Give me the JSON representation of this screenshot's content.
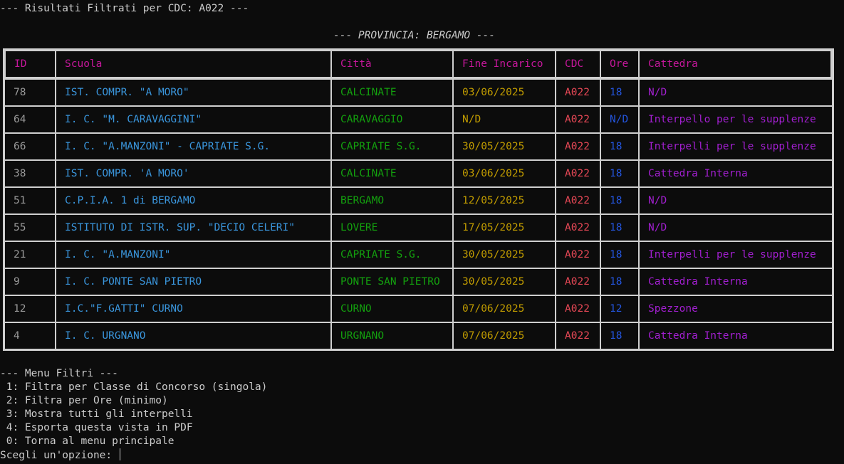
{
  "header": {
    "title": "--- Risultati Filtrati per CDC: A022 ---",
    "province": "--- PROVINCIA: BERGAMO ---"
  },
  "table": {
    "columns": [
      "ID",
      "Scuola",
      "Città",
      "Fine Incarico",
      "CDC",
      "Ore",
      "Cattedra"
    ],
    "rows": [
      {
        "id": "78",
        "scuola": "IST. COMPR. \"A MORO\"",
        "citta": "CALCINATE",
        "fine": "03/06/2025",
        "cdc": "A022",
        "ore": "18",
        "cattedra": "N/D"
      },
      {
        "id": "64",
        "scuola": "I. C. \"M. CARAVAGGINI\"",
        "citta": "CARAVAGGIO",
        "fine": "N/D",
        "cdc": "A022",
        "ore": "N/D",
        "cattedra": "Interpello per le supplenze"
      },
      {
        "id": "66",
        "scuola": "I. C. \"A.MANZONI\" - CAPRIATE S.G.",
        "citta": "CAPRIATE S.G.",
        "fine": "30/05/2025",
        "cdc": "A022",
        "ore": "18",
        "cattedra": "Interpelli per le supplenze"
      },
      {
        "id": "38",
        "scuola": "IST. COMPR. 'A MORO'",
        "citta": "CALCINATE",
        "fine": "03/06/2025",
        "cdc": "A022",
        "ore": "18",
        "cattedra": "Cattedra Interna"
      },
      {
        "id": "51",
        "scuola": "C.P.I.A. 1 di BERGAMO",
        "citta": "BERGAMO",
        "fine": "12/05/2025",
        "cdc": "A022",
        "ore": "18",
        "cattedra": "N/D"
      },
      {
        "id": "55",
        "scuola": "ISTITUTO DI ISTR. SUP. \"DECIO CELERI\"",
        "citta": "LOVERE",
        "fine": "17/05/2025",
        "cdc": "A022",
        "ore": "18",
        "cattedra": "N/D"
      },
      {
        "id": "21",
        "scuola": "I. C. \"A.MANZONI\"",
        "citta": "CAPRIATE S.G.",
        "fine": "30/05/2025",
        "cdc": "A022",
        "ore": "18",
        "cattedra": "Interpelli per le supplenze"
      },
      {
        "id": "9",
        "scuola": "I. C. PONTE SAN PIETRO",
        "citta": "PONTE SAN PIETRO",
        "fine": "30/05/2025",
        "cdc": "A022",
        "ore": "18",
        "cattedra": "Cattedra Interna"
      },
      {
        "id": "12",
        "scuola": "I.C.\"F.GATTI\" CURNO",
        "citta": "CURNO",
        "fine": "07/06/2025",
        "cdc": "A022",
        "ore": "12",
        "cattedra": "Spezzone"
      },
      {
        "id": "4",
        "scuola": "I. C. URGNANO",
        "citta": "URGNANO",
        "fine": "07/06/2025",
        "cdc": "A022",
        "ore": "18",
        "cattedra": "Cattedra Interna"
      }
    ]
  },
  "menu": {
    "title": "--- Menu Filtri ---",
    "options": [
      " 1: Filtra per Classe di Concorso (singola)",
      " 2: Filtra per Ore (minimo)",
      " 3: Mostra tutti gli interpelli",
      " 4: Esporta questa vista in PDF",
      " 0: Torna al menu principale"
    ],
    "prompt": "Scegli un'opzione: "
  }
}
